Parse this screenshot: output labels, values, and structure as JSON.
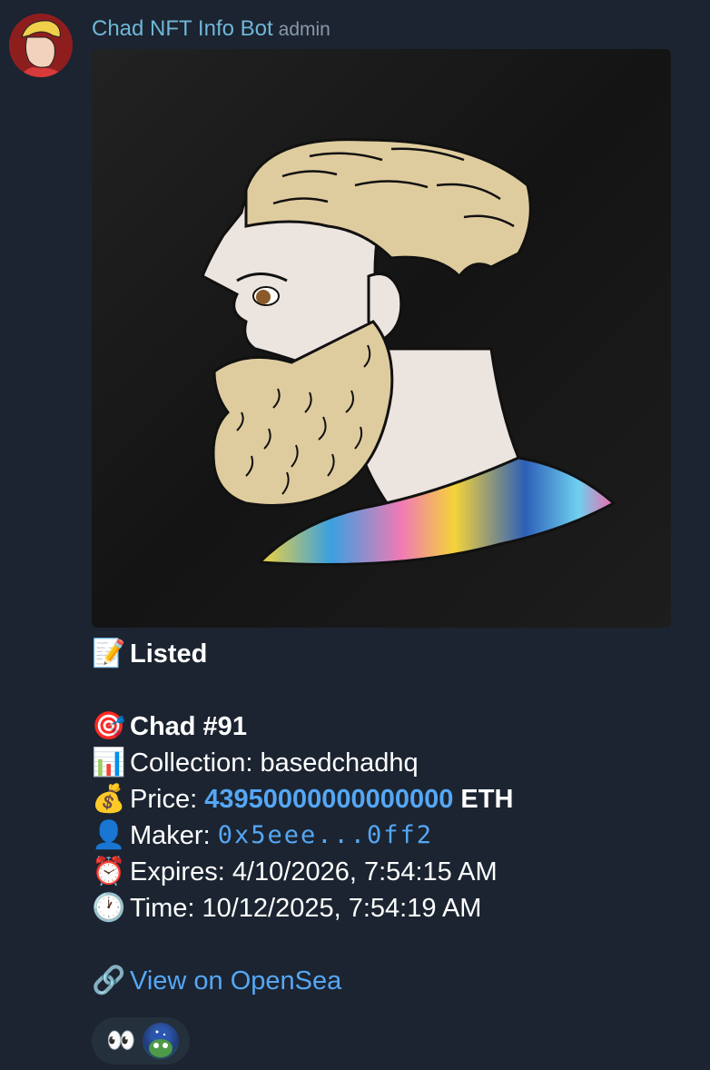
{
  "message": {
    "sender_name": "Chad NFT Info Bot",
    "sender_role": "admin",
    "avatar_icon": "chad-avatar-icon",
    "media_icon": "chad-nft-image"
  },
  "caption": {
    "status_emoji": "📝",
    "status": "Listed",
    "title_emoji": "🎯",
    "title": "Chad #91",
    "collection_emoji": "📊",
    "collection_label": "Collection: ",
    "collection_value": "basedchadhq",
    "price_emoji": "💰",
    "price_label": "Price: ",
    "price_value": "43950000000000000",
    "price_unit": " ETH",
    "maker_emoji": "👤",
    "maker_label": "Maker: ",
    "maker_value": "0x5eee...0ff2",
    "expires_emoji": "⏰",
    "expires_text": "Expires: 4/10/2026, 7:54:15 AM",
    "time_emoji": "🕐",
    "time_text": "Time: 10/12/2025, 7:54:19 AM",
    "link_emoji": "🔗",
    "link_text": "View on OpenSea"
  },
  "reactions": {
    "emoji": "👀",
    "reactor_icon": "reactor-avatar-icon"
  },
  "colors": {
    "background": "#1b2430",
    "sender": "#6fb6d8",
    "link": "#55a7f5"
  }
}
